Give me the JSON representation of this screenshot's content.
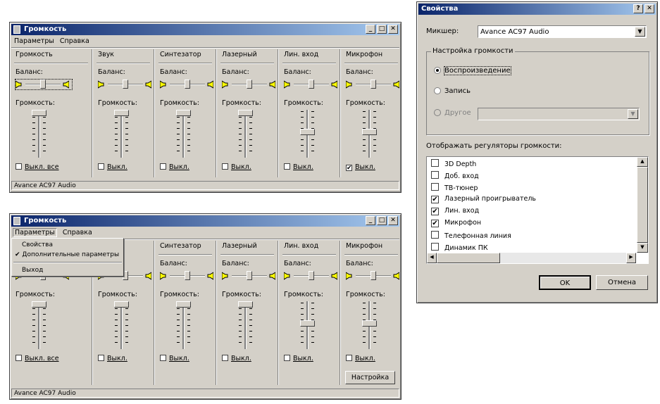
{
  "window1": {
    "title": "Громкость",
    "menu": [
      "Параметры",
      "Справка"
    ],
    "status": "Avance AC97 Audio",
    "master": {
      "heading": "Громкость",
      "balance_label": "Баланс:",
      "volume_label": "Громкость:",
      "mute_label": "Выкл. все",
      "muted": false,
      "balance_level": 0.5,
      "volume_level": 0.0
    },
    "channels": [
      {
        "heading": "Звук",
        "balance_label": "Баланс:",
        "volume_label": "Громкость:",
        "mute_label": "Выкл.",
        "muted": false,
        "balance_level": 0.5,
        "volume_level": 0.0
      },
      {
        "heading": "Синтезатор",
        "balance_label": "Баланс:",
        "volume_label": "Громкость:",
        "mute_label": "Выкл.",
        "muted": false,
        "balance_level": 0.5,
        "volume_level": 0.0
      },
      {
        "heading": "Лазерный",
        "balance_label": "Баланс:",
        "volume_label": "Громкость:",
        "mute_label": "Выкл.",
        "muted": false,
        "balance_level": 0.5,
        "volume_level": 0.0
      },
      {
        "heading": "Лин. вход",
        "balance_label": "Баланс:",
        "volume_label": "Громкость:",
        "mute_label": "Выкл.",
        "muted": false,
        "balance_level": 0.5,
        "volume_level": 0.45
      },
      {
        "heading": "Микрофон",
        "balance_label": "Баланс:",
        "volume_label": "Громкость:",
        "mute_label": "Выкл.",
        "muted": true,
        "balance_level": 0.5,
        "volume_level": 0.45
      }
    ]
  },
  "window2": {
    "title": "Громкость",
    "menu": [
      "Параметры",
      "Справка"
    ],
    "status": "Avance AC97 Audio",
    "dropdown": {
      "items": [
        "Свойства",
        "Дополнительные параметры",
        "Выход"
      ],
      "checked_index": 1
    },
    "master": {
      "balance_label": "Баланс:",
      "volume_label": "Громкость:",
      "mute_label": "Выкл. все",
      "muted": false,
      "balance_level": 0.5,
      "volume_level": 0.0
    },
    "channels": [
      {
        "heading": "",
        "balance_label": "",
        "volume_label": "Громкость:",
        "mute_label": "Выкл.",
        "muted": false,
        "balance_level": 0.5,
        "volume_level": 0.0
      },
      {
        "heading": "Синтезатор",
        "balance_label": "Баланс:",
        "volume_label": "Громкость:",
        "mute_label": "Выкл.",
        "muted": false,
        "balance_level": 0.5,
        "volume_level": 0.0
      },
      {
        "heading": "Лазерный",
        "balance_label": "Баланс:",
        "volume_label": "Громкость:",
        "mute_label": "Выкл.",
        "muted": false,
        "balance_level": 0.5,
        "volume_level": 0.0
      },
      {
        "heading": "Лин. вход",
        "balance_label": "Баланс:",
        "volume_label": "Громкость:",
        "mute_label": "Выкл.",
        "muted": false,
        "balance_level": 0.5,
        "volume_level": 0.45
      },
      {
        "heading": "Микрофон",
        "balance_label": "Баланс:",
        "volume_label": "Громкость:",
        "mute_label": "Выкл.",
        "muted": false,
        "balance_level": 0.5,
        "volume_level": 0.45
      }
    ],
    "settings_button": "Настройка"
  },
  "properties": {
    "title": "Свойства",
    "help_button": "?",
    "close_button": "✕",
    "mixer_label": "Микшер:",
    "mixer_value": "Avance AC97 Audio",
    "group_label": "Настройка громкости",
    "radios": [
      {
        "label": "Воспроизведение",
        "selected": true,
        "enabled": true
      },
      {
        "label": "Запись",
        "selected": false,
        "enabled": true
      },
      {
        "label": "Другое",
        "selected": false,
        "enabled": false
      }
    ],
    "show_controls_label": "Отображать регуляторы громкости:",
    "list": [
      {
        "label": "3D Depth",
        "checked": false
      },
      {
        "label": "Доб. вход",
        "checked": false
      },
      {
        "label": "ТВ-тюнер",
        "checked": false
      },
      {
        "label": "Лазерный проигрыватель",
        "checked": true
      },
      {
        "label": "Лин. вход",
        "checked": true
      },
      {
        "label": "Микрофон",
        "checked": true
      },
      {
        "label": "Телефонная линия",
        "checked": false
      },
      {
        "label": "Динамик ПК",
        "checked": false
      }
    ],
    "ok_button": "OK",
    "cancel_button": "Отмена"
  }
}
